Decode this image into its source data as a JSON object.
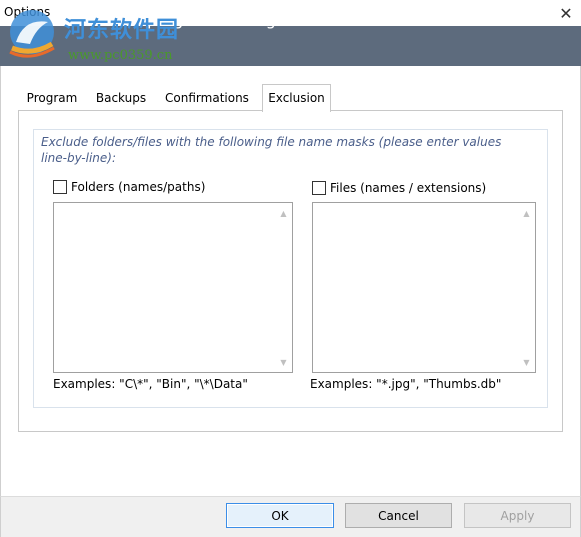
{
  "window": {
    "title": "Options",
    "close_glyph": "✕"
  },
  "header": {
    "title": "Customize program settings",
    "watermark_text": "河东软件园",
    "watermark_url": "www.pc0359.cn"
  },
  "tabs": [
    {
      "label": "Program",
      "active": false
    },
    {
      "label": "Backups",
      "active": false
    },
    {
      "label": "Confirmations",
      "active": false
    },
    {
      "label": "Exclusion",
      "active": true
    }
  ],
  "exclusion": {
    "description": "Exclude folders/files with the following file name masks (please enter values line-by-line):",
    "folders": {
      "label": "Folders (names/paths)",
      "checked": false,
      "value": "",
      "example": "Examples: \"C\\*\", \"Bin\", \"\\*\\Data\""
    },
    "files": {
      "label": "Files (names / extensions)",
      "checked": false,
      "value": "",
      "example": "Examples: \"*.jpg\", \"Thumbs.db\""
    }
  },
  "footer": {
    "ok_label": "OK",
    "cancel_label": "Cancel",
    "apply_label": "Apply"
  },
  "icons": {
    "scroll_up": "▲",
    "scroll_down": "▼"
  },
  "colors": {
    "header_bg": "#5d6b7d",
    "description_text": "#4a5e8a",
    "default_button_border": "#3b8ee8"
  }
}
